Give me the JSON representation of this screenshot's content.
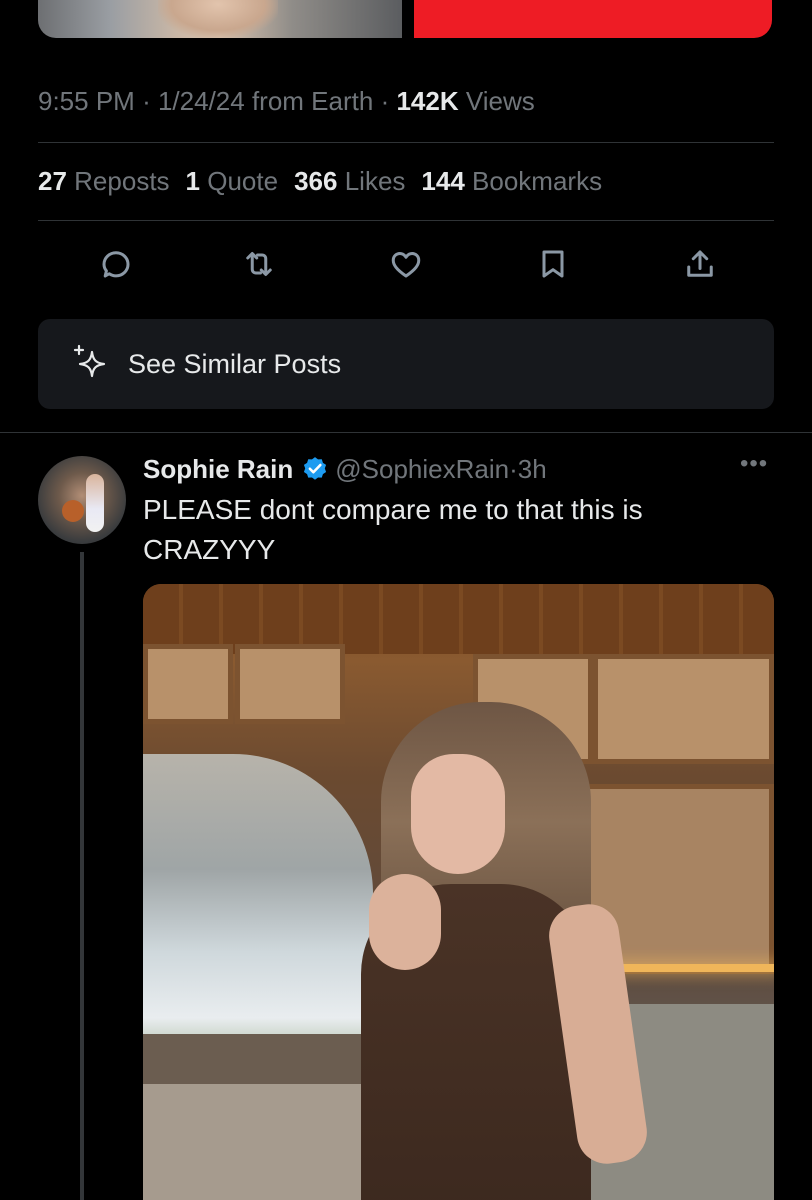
{
  "prev_post": {
    "meta": {
      "time": "9:55 PM",
      "separator": "·",
      "date": "1/24/24",
      "source": "from Earth",
      "views_count": "142K",
      "views_label": "Views"
    },
    "stats": [
      {
        "count": "27",
        "label": "Reposts"
      },
      {
        "count": "1",
        "label": "Quote"
      },
      {
        "count": "366",
        "label": "Likes"
      },
      {
        "count": "144",
        "label": "Bookmarks"
      }
    ],
    "actions": [
      "reply-icon",
      "repost-icon",
      "like-icon",
      "bookmark-icon",
      "share-icon"
    ],
    "see_similar": "See Similar Posts"
  },
  "reply": {
    "name": "Sophie Rain",
    "verified": true,
    "handle": "@SophiexRain",
    "separator": "·",
    "time": "3h",
    "more": "•••",
    "text": "PLEASE dont compare me to that this is CRAZYYY"
  },
  "colors": {
    "background": "#000000",
    "text_primary": "#e7e9ea",
    "text_secondary": "#71767b",
    "divider": "#2f3336",
    "verified_badge": "#1d9bf0",
    "redacted_block": "#ee1c25"
  }
}
